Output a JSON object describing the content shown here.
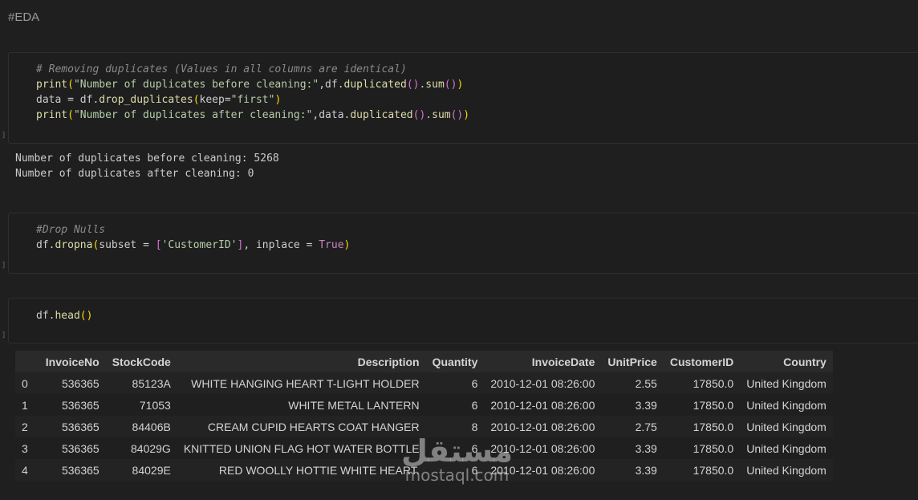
{
  "heading": "#EDA",
  "cells": {
    "dup": {
      "line1": "# Removing duplicates (Values in all columns are identical)",
      "line2": {
        "print": "print",
        "open": "(",
        "str": "\"Number of duplicates before cleaning:\"",
        "rest1": ",df.",
        "fn1": "duplicated",
        "p1": "()",
        "dot": ".",
        "fn2": "sum",
        "p2": "()",
        "close": ")"
      },
      "line3": {
        "var": "data",
        "eq": " = df.",
        "fn": "drop_duplicates",
        "open": "(",
        "arg": "keep=",
        "str": "\"first\"",
        "close": ")"
      },
      "line4": {
        "print": "print",
        "open": "(",
        "str": "\"Number of duplicates after cleaning:\"",
        "rest1": ",data.",
        "fn1": "duplicated",
        "p1": "()",
        "dot": ".",
        "fn2": "sum",
        "p2": "()",
        "close": ")"
      }
    },
    "dup_output": [
      "Number of duplicates before cleaning: 5268",
      "Number of duplicates after cleaning: 0"
    ],
    "dropna": {
      "comment": "#Drop Nulls",
      "var": "df.",
      "fn": "dropna",
      "open": "(",
      "arg1": "subset = ",
      "bopen": "[",
      "str": "'CustomerID'",
      "bclose": "]",
      "arg2": ", inplace = ",
      "true": "True",
      "close": ")"
    },
    "head": {
      "var": "df.",
      "fn": "head",
      "parens": "()"
    }
  },
  "table": {
    "columns": [
      "",
      "InvoiceNo",
      "StockCode",
      "Description",
      "Quantity",
      "InvoiceDate",
      "UnitPrice",
      "CustomerID",
      "Country"
    ],
    "rows": [
      [
        "0",
        "536365",
        "85123A",
        "WHITE HANGING HEART T-LIGHT HOLDER",
        "6",
        "2010-12-01 08:26:00",
        "2.55",
        "17850.0",
        "United Kingdom"
      ],
      [
        "1",
        "536365",
        "71053",
        "WHITE METAL LANTERN",
        "6",
        "2010-12-01 08:26:00",
        "3.39",
        "17850.0",
        "United Kingdom"
      ],
      [
        "2",
        "536365",
        "84406B",
        "CREAM CUPID HEARTS COAT HANGER",
        "8",
        "2010-12-01 08:26:00",
        "2.75",
        "17850.0",
        "United Kingdom"
      ],
      [
        "3",
        "536365",
        "84029G",
        "KNITTED UNION FLAG HOT WATER BOTTLE",
        "6",
        "2010-12-01 08:26:00",
        "3.39",
        "17850.0",
        "United Kingdom"
      ],
      [
        "4",
        "536365",
        "84029E",
        "RED WOOLLY HOTTIE WHITE HEART.",
        "6",
        "2010-12-01 08:26:00",
        "3.39",
        "17850.0",
        "United Kingdom"
      ]
    ]
  },
  "watermark": {
    "arabic": "مستقل",
    "latin": "mostaql.com"
  }
}
